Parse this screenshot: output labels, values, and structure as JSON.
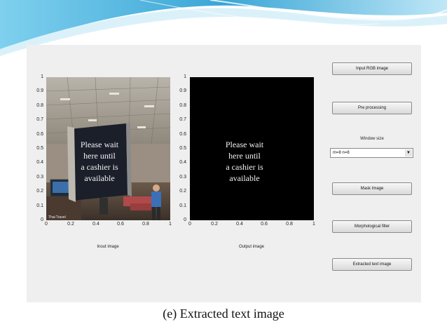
{
  "gui": {
    "left_axes": {
      "yticks": [
        "1",
        "0.9",
        "0.8",
        "0.7",
        "0.6",
        "0.5",
        "0.4",
        "0.3",
        "0.2",
        "0.1",
        "0"
      ],
      "xticks": [
        "0",
        "0.2",
        "0.4",
        "0.6",
        "0.8",
        "1"
      ],
      "caption": "Inout image",
      "sign_lines": [
        "Please wait",
        "here until",
        "a cashier is",
        "available"
      ],
      "corner_text": "Thai Travel"
    },
    "right_axes": {
      "yticks": [
        "1",
        "0.9",
        "0.8",
        "0.7",
        "0.6",
        "0.5",
        "0.4",
        "0.3",
        "0.2",
        "0.1",
        "0"
      ],
      "xticks": [
        "0",
        "0.2",
        "0.4",
        "0.6",
        "0.8",
        "1"
      ],
      "caption": "Output image",
      "text_lines": [
        "Please wait",
        "here until",
        "a cashier is",
        "available"
      ]
    },
    "buttons": {
      "input_rgb": "Input RGB image",
      "pre_processing": "Pre processing",
      "mask_image": "Mask Image",
      "morph_filter": "Morphological filter",
      "extracted_text": "Extracted text image"
    },
    "window_size": {
      "label": "Window size",
      "selected": "m=8 n=8"
    }
  },
  "slide": {
    "caption": "(e) Extracted text image"
  },
  "colors": {
    "deco_teal": "#3aa6d6",
    "window_bg": "#efefef"
  }
}
